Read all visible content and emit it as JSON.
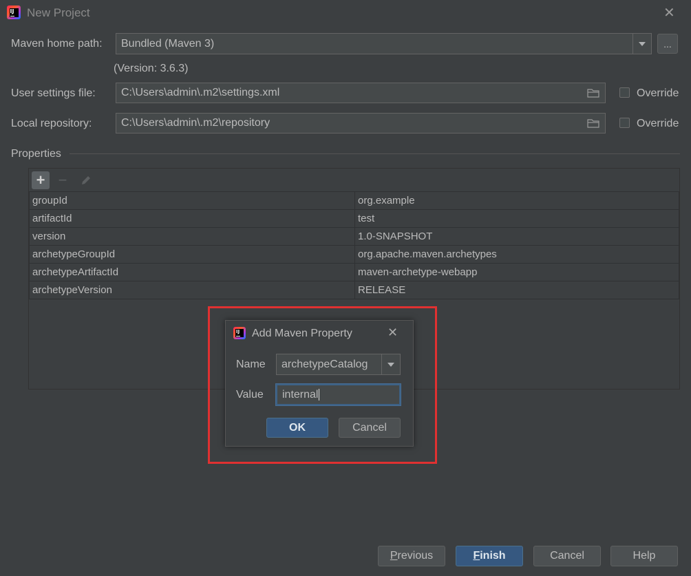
{
  "window": {
    "title": "New Project",
    "close_glyph": "✕"
  },
  "form": {
    "maven_home_label": "Maven home path:",
    "maven_home_value": "Bundled (Maven 3)",
    "maven_home_browse": "...",
    "version_text": "(Version: 3.6.3)",
    "user_settings_label": "User settings file:",
    "user_settings_value": "C:\\Users\\admin\\.m2\\settings.xml",
    "user_settings_override": "Override",
    "local_repo_label": "Local repository:",
    "local_repo_value": "C:\\Users\\admin\\.m2\\repository",
    "local_repo_override": "Override"
  },
  "properties": {
    "section_label": "Properties",
    "toolbar": {
      "add": "+",
      "remove": "−"
    },
    "rows": [
      {
        "name": "groupId",
        "value": "org.example"
      },
      {
        "name": "artifactId",
        "value": "test"
      },
      {
        "name": "version",
        "value": "1.0-SNAPSHOT"
      },
      {
        "name": "archetypeGroupId",
        "value": "org.apache.maven.archetypes"
      },
      {
        "name": "archetypeArtifactId",
        "value": "maven-archetype-webapp"
      },
      {
        "name": "archetypeVersion",
        "value": "RELEASE"
      }
    ]
  },
  "dialog": {
    "title": "Add Maven Property",
    "close_glyph": "✕",
    "name_label": "Name",
    "name_value": "archetypeCatalog",
    "value_label": "Value",
    "value_value": "internal",
    "ok": "OK",
    "cancel": "Cancel"
  },
  "footer": {
    "previous": "Previous",
    "finish": "Finish",
    "cancel": "Cancel",
    "help": "Help"
  },
  "colors": {
    "background": "#3c3f41",
    "highlight_box": "#e03131",
    "default_button": "#365880"
  },
  "icons": [
    "intellij-app-icon",
    "close-icon",
    "chevron-down-icon",
    "folder-icon",
    "plus-icon",
    "minus-icon",
    "pencil-icon"
  ]
}
